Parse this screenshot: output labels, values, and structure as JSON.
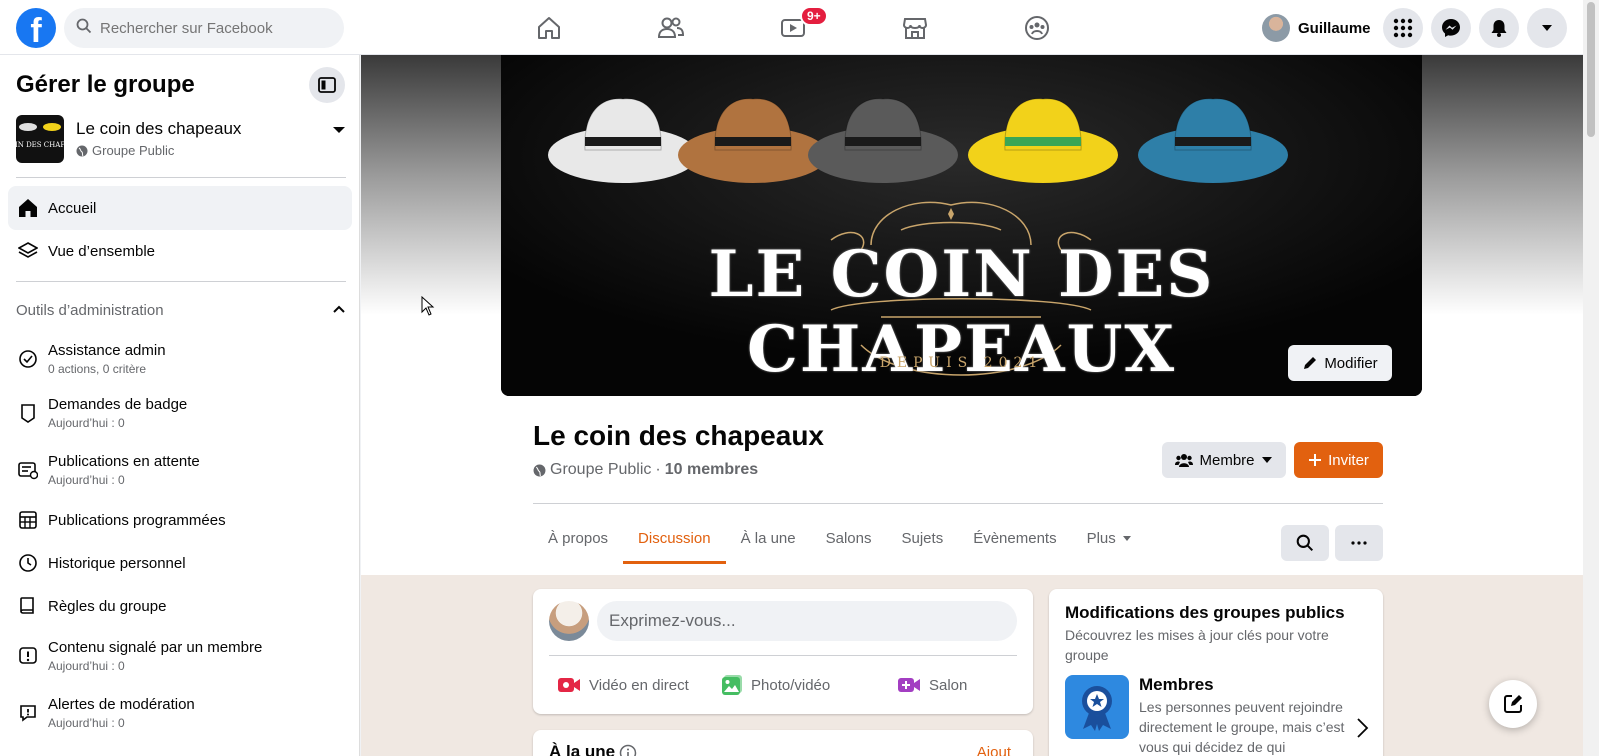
{
  "topbar": {
    "logo": "f",
    "search_placeholder": "Rechercher sur Facebook",
    "watch_badge": "9+",
    "user_name": "Guillaume"
  },
  "sidebar": {
    "title": "Gérer le groupe",
    "group_name": "Le coin des chapeaux",
    "group_type": "Groupe Public",
    "thumb_text": "IN DES CHAP",
    "items": [
      {
        "label": "Accueil",
        "icon": "home-icon"
      },
      {
        "label": "Vue d’ensemble",
        "icon": "layers-icon"
      }
    ],
    "section_title": "Outils d’administration",
    "tools": [
      {
        "label": "Assistance admin",
        "sub": "0 actions, 0 critère",
        "icon": "admin-assist-icon"
      },
      {
        "label": "Demandes de badge",
        "sub": "Aujourd’hui : 0",
        "icon": "badge-icon"
      },
      {
        "label": "Publications en attente",
        "sub": "Aujourd’hui : 0",
        "icon": "pending-posts-icon"
      },
      {
        "label": "Publications programmées",
        "sub": "",
        "icon": "scheduled-icon"
      },
      {
        "label": "Historique personnel",
        "sub": "",
        "icon": "clock-icon"
      },
      {
        "label": "Règles du groupe",
        "sub": "",
        "icon": "book-icon"
      },
      {
        "label": "Contenu signalé par un membre",
        "sub": "Aujourd’hui : 0",
        "icon": "report-icon"
      },
      {
        "label": "Alertes de modération",
        "sub": "Aujourd’hui : 0",
        "icon": "alert-icon"
      }
    ]
  },
  "cover": {
    "title": "LE COIN DES CHAPEAUX",
    "since": "DEPUIS 2021",
    "modify_label": "Modifier",
    "hat_colors": [
      "#e8e8e8",
      "#b0733f",
      "#5a5a5a",
      "#f2d21a",
      "#2e7fa8"
    ]
  },
  "group": {
    "title": "Le coin des chapeaux",
    "type": "Groupe Public",
    "members": "10 membres",
    "member_button": "Membre",
    "invite_button": "Inviter"
  },
  "tabs": [
    {
      "label": "À propos",
      "active": false
    },
    {
      "label": "Discussion",
      "active": true
    },
    {
      "label": "À la une",
      "active": false
    },
    {
      "label": "Salons",
      "active": false
    },
    {
      "label": "Sujets",
      "active": false
    },
    {
      "label": "Évènements",
      "active": false
    },
    {
      "label": "Plus",
      "active": false
    }
  ],
  "composer": {
    "placeholder": "Exprimez-vous...",
    "live_video": "Vidéo en direct",
    "photo_video": "Photo/vidéo",
    "room": "Salon"
  },
  "featured": {
    "title": "À la une",
    "right": "Ajout"
  },
  "side_card": {
    "title": "Modifications des groupes publics",
    "desc": "Découvrez les mises à jour clés pour votre groupe",
    "item_title": "Membres",
    "item_desc": "Les personnes peuvent rejoindre directement le groupe, mais c’est vous qui décidez de qui"
  },
  "colors": {
    "brand": "#1877f2",
    "accent": "#e2610f",
    "notification": "#e41e3f"
  }
}
